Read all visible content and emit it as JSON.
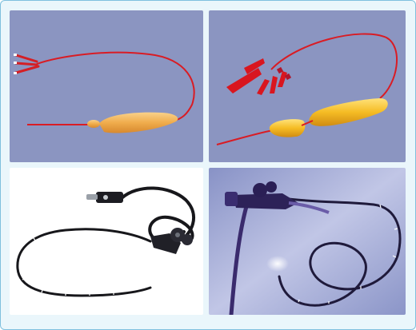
{
  "figure": {
    "panels": [
      {
        "image": "double-lumen-balloon-catheter-deflated",
        "background": "#8b95c1"
      },
      {
        "image": "double-balloon-catheter-inflated",
        "background": "#8b95c1"
      },
      {
        "image": "flexible-endoscope-on-white",
        "background": "#ffffff"
      },
      {
        "image": "flexible-endoscope-on-blue-gradient",
        "background": "#9ea8d6"
      }
    ],
    "colors": {
      "frame_border": "#7fc0de",
      "frame_fill": "#eaf6fb",
      "catheter_red": "#e0201f",
      "balloon_orange": "#f2b65a",
      "balloon_yellow": "#f6c430",
      "scope_black": "#17171b",
      "scope_purple": "#3d2a6e"
    }
  }
}
